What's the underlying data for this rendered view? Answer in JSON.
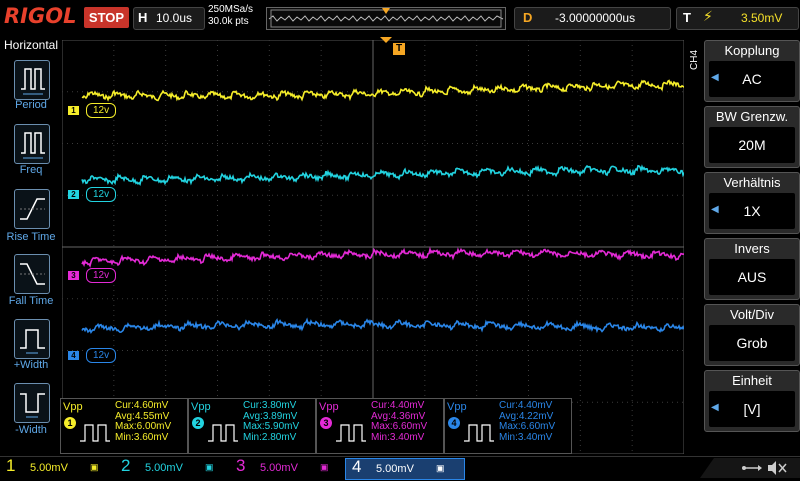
{
  "header": {
    "brand": "RIGOL",
    "run_state": "STOP",
    "horizontal_label": "H",
    "timebase": "10.0us",
    "sample_rate": "250MSa/s",
    "mem_depth": "30.0k pts",
    "delay_label": "D",
    "delay_value": "-3.00000000us",
    "trigger_label": "T",
    "trigger_symbol": "⚡",
    "trigger_level": "3.50mV"
  },
  "left_menu": {
    "title": "Horizontal",
    "items": [
      "Period",
      "Freq",
      "Rise Time",
      "Fall Time",
      "+Width",
      "-Width"
    ]
  },
  "right_menu": {
    "channel_tag": "CH4",
    "items": [
      {
        "title": "Kopplung",
        "value": "AC"
      },
      {
        "title": "BW Grenzw.",
        "value": "20M"
      },
      {
        "title": "Verhältnis",
        "value": "1X"
      },
      {
        "title": "Invers",
        "value": "AUS"
      },
      {
        "title": "Volt/Div",
        "value": "Grob"
      },
      {
        "title": "Einheit",
        "value": "[V]"
      }
    ]
  },
  "channels": [
    {
      "id": "1",
      "color": "#f5ed2a",
      "scale_tag": "12v",
      "vdiv": "5.00mV"
    },
    {
      "id": "2",
      "color": "#22d3e0",
      "scale_tag": "12v",
      "vdiv": "5.00mV"
    },
    {
      "id": "3",
      "color": "#e42ad6",
      "scale_tag": "12v",
      "vdiv": "5.00mV"
    },
    {
      "id": "4",
      "color": "#2a86e8",
      "scale_tag": "12v",
      "vdiv": "5.00mV"
    }
  ],
  "trigger_marker": "T",
  "measurements": [
    {
      "label": "Vpp",
      "channel": "1",
      "color": "#f5ed2a",
      "cur": "Cur:4.60mV",
      "avg": "Avg:4.55mV",
      "max": "Max:6.00mV",
      "min": "Min:3.60mV"
    },
    {
      "label": "Vpp",
      "channel": "2",
      "color": "#22d3e0",
      "cur": "Cur:3.80mV",
      "avg": "Avg:3.89mV",
      "max": "Max:5.90mV",
      "min": "Min:2.80mV"
    },
    {
      "label": "Vpp",
      "channel": "3",
      "color": "#e42ad6",
      "cur": "Cur:4.40mV",
      "avg": "Avg:4.36mV",
      "max": "Max:6.60mV",
      "min": "Min:3.40mV"
    },
    {
      "label": "Vpp",
      "channel": "4",
      "color": "#2a86e8",
      "cur": "Cur:4.40mV",
      "avg": "Avg:4.22mV",
      "max": "Max:6.60mV",
      "min": "Min:3.40mV"
    }
  ]
}
